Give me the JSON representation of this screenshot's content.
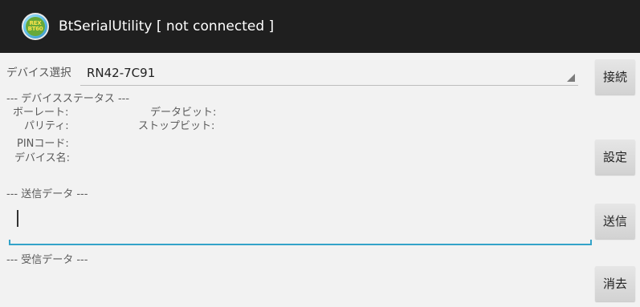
{
  "titlebar": {
    "app_icon_text_line1": "REX",
    "app_icon_text_line2": "BT60",
    "title": "BtSerialUtility [ not connected ]"
  },
  "device_select": {
    "label": "デバイス選択",
    "value": "RN42-7C91"
  },
  "device_status": {
    "header": "--- デバイスステータス ---",
    "baud_rate_label": "ボーレート:",
    "data_bits_label": "データビット:",
    "parity_label": "パリティ:",
    "stop_bits_label": "ストップビット:",
    "pin_code_label": "PINコード:",
    "device_name_label": "デバイス名:"
  },
  "send": {
    "header": "--- 送信データ ---",
    "value": ""
  },
  "receive": {
    "header": "--- 受信データ ---"
  },
  "buttons": {
    "connect": "接続",
    "settings": "設定",
    "send": "送信",
    "clear": "消去"
  },
  "colors": {
    "titlebar_bg": "#1f1f1f",
    "background": "#f2f2f2",
    "accent_underline": "#33a3c9",
    "button_bg": "#dcdcdc"
  }
}
